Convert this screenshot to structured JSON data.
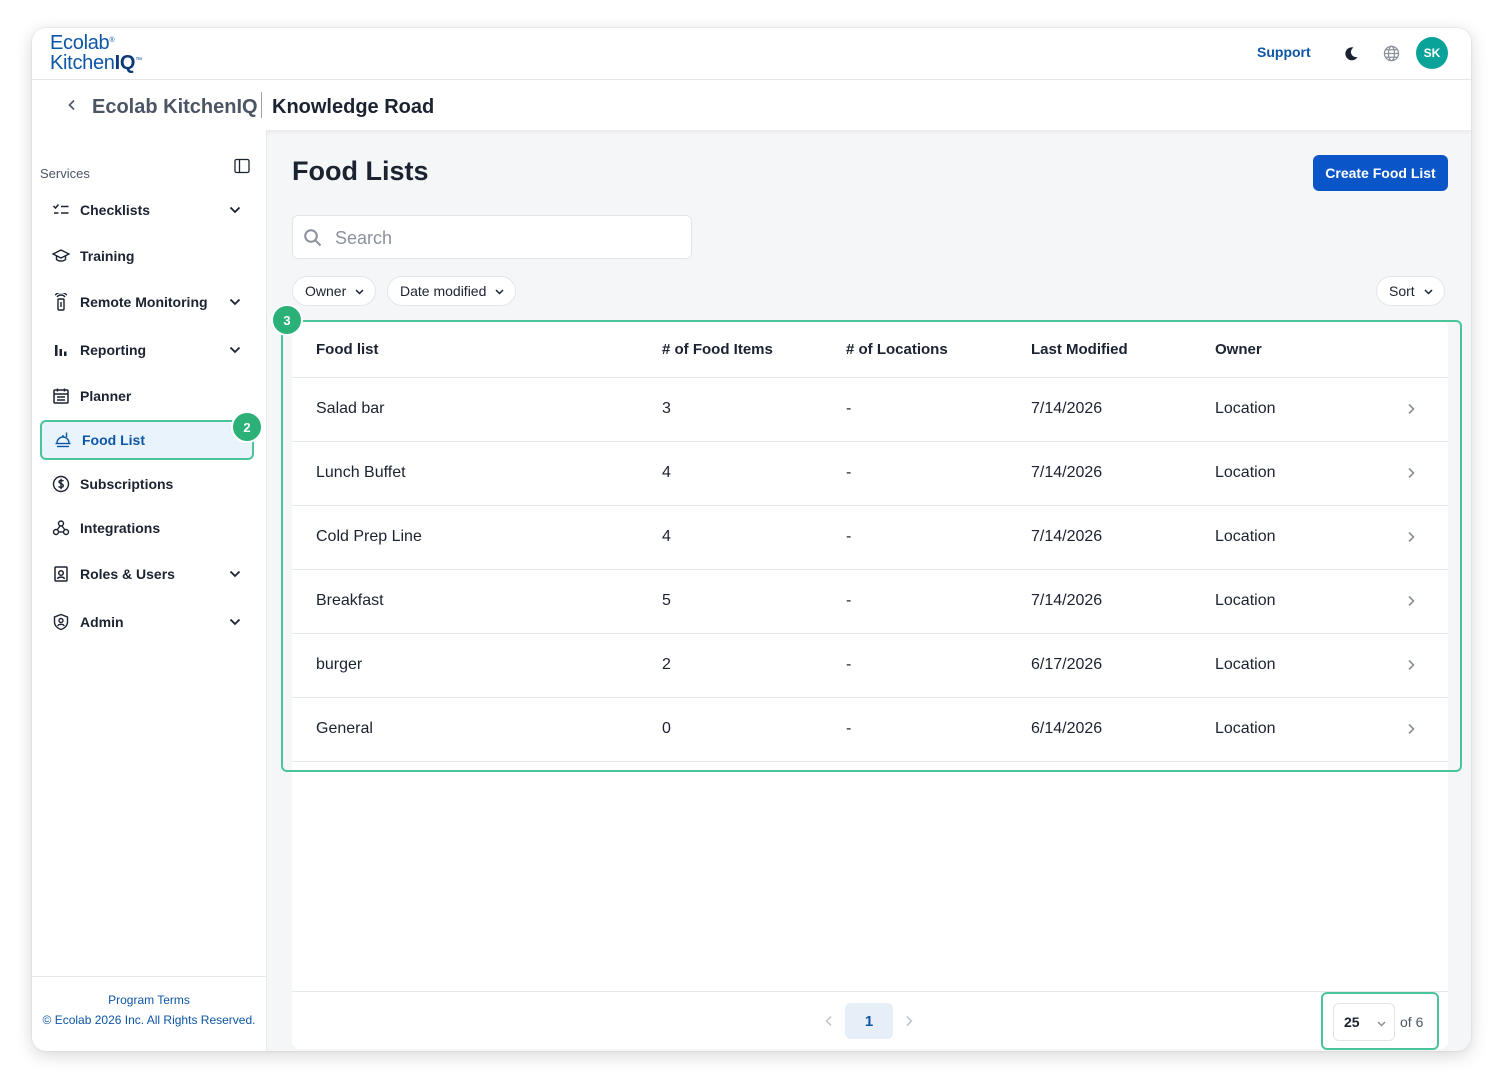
{
  "header": {
    "logo_line1": "Ecolab",
    "logo_line2_a": "Kitchen",
    "logo_line2_b": "IQ",
    "logo_reg": "®",
    "logo_tm": "™",
    "support": "Support",
    "avatar_initials": "SK"
  },
  "breadcrumb": {
    "app": "Ecolab KitchenIQ",
    "site": "Knowledge Road"
  },
  "sidebar": {
    "section_label": "Services",
    "items": [
      {
        "label": "Checklists",
        "icon": "checklist-icon",
        "expandable": true
      },
      {
        "label": "Training",
        "icon": "graduation-cap-icon",
        "expandable": false
      },
      {
        "label": "Remote Monitoring",
        "icon": "sensor-icon",
        "expandable": true
      },
      {
        "label": "Reporting",
        "icon": "bar-chart-icon",
        "expandable": true
      },
      {
        "label": "Planner",
        "icon": "calendar-icon",
        "expandable": false
      },
      {
        "label": "Food List",
        "icon": "food-tray-icon",
        "expandable": false,
        "active": true
      },
      {
        "label": "Subscriptions",
        "icon": "dollar-circle-icon",
        "expandable": false
      },
      {
        "label": "Integrations",
        "icon": "webhook-icon",
        "expandable": false
      },
      {
        "label": "Roles & Users",
        "icon": "id-badge-icon",
        "expandable": true
      },
      {
        "label": "Admin",
        "icon": "shield-user-icon",
        "expandable": true
      }
    ],
    "footer_terms": "Program Terms",
    "footer_copyright": "© Ecolab 2026 Inc. All Rights Reserved."
  },
  "annotations": {
    "badge_sidebar": "2",
    "badge_table": "3"
  },
  "main": {
    "title": "Food Lists",
    "create_button": "Create Food List",
    "search_placeholder": "Search",
    "filters": [
      "Owner",
      "Date modified"
    ],
    "sort_label": "Sort",
    "table": {
      "columns": [
        "Food list",
        "# of Food Items",
        "# of Locations",
        "Last Modified",
        "Owner"
      ],
      "rows": [
        [
          "Salad bar",
          "3",
          "-",
          "7/14/2026",
          "Location"
        ],
        [
          "Lunch Buffet",
          "4",
          "-",
          "7/14/2026",
          "Location"
        ],
        [
          "Cold Prep Line",
          "4",
          "-",
          "7/14/2026",
          "Location"
        ],
        [
          "Breakfast",
          "5",
          "-",
          "7/14/2026",
          "Location"
        ],
        [
          "burger",
          "2",
          "-",
          "6/17/2026",
          "Location"
        ],
        [
          "General",
          "0",
          "-",
          "6/14/2026",
          "Location"
        ]
      ]
    },
    "pagination": {
      "current_page": "1",
      "per_page": "25",
      "of_text": "of 6"
    }
  },
  "colors": {
    "brand_blue": "#0d56a6",
    "button_blue": "#0a56c8",
    "avatar_teal": "#0aa39a",
    "highlight_green": "#4cc49a",
    "badge_green": "#2bb078"
  }
}
